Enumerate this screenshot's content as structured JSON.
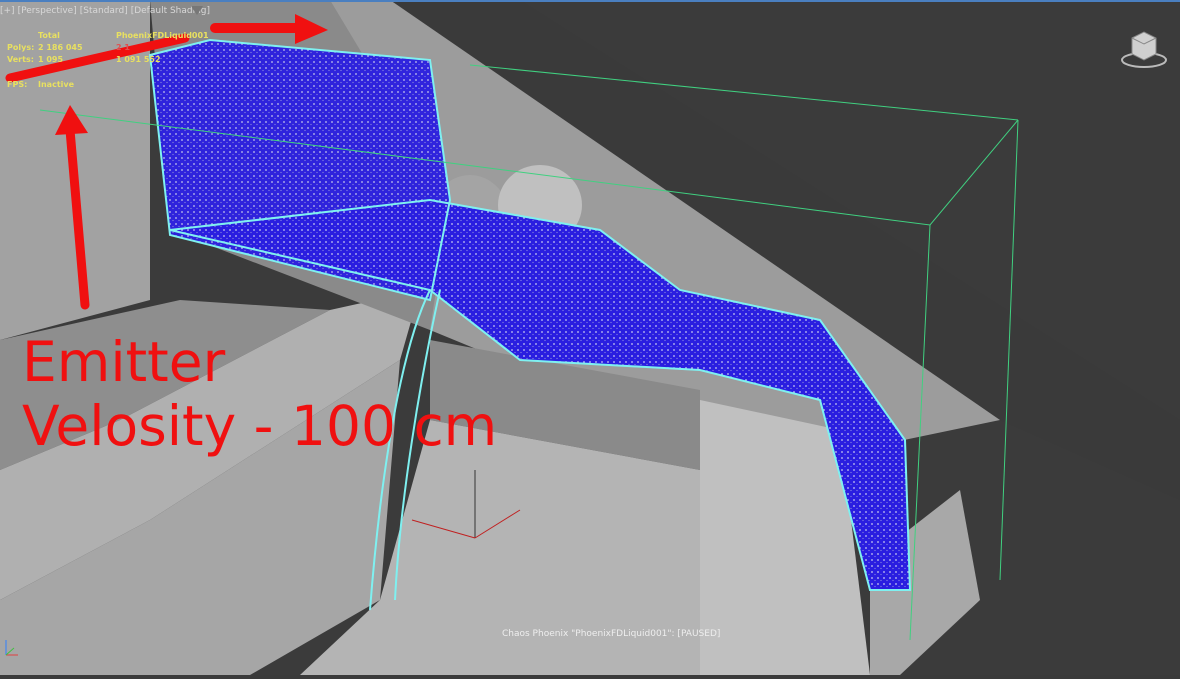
{
  "viewport": {
    "labels": [
      "[+]",
      "[Perspective]",
      "[Standard]",
      "[Default Shading]"
    ],
    "stats": {
      "col_total": "Total",
      "col_object": "PhoenixFDLiquid001",
      "polys_label": "Polys:",
      "polys_total": "2 186 045",
      "polys_object": "2 1",
      "verts_label": "Verts:",
      "verts_total": "1 095 ",
      "verts_object": "1 091 552",
      "fps_label": "FPS:",
      "fps_value": "Inactive"
    },
    "status": "Chaos Phoenix \"PhoenixFDLiquid001\": [PAUSED]"
  },
  "annotation": {
    "line1": "Emitter",
    "line2": "Velosity - 100 cm",
    "color": "#f01010"
  },
  "colors": {
    "liquid": "#2a1ee0",
    "outline": "#7ff0f0",
    "bbox": "#40d080",
    "geometry": "#a8a8a8"
  }
}
